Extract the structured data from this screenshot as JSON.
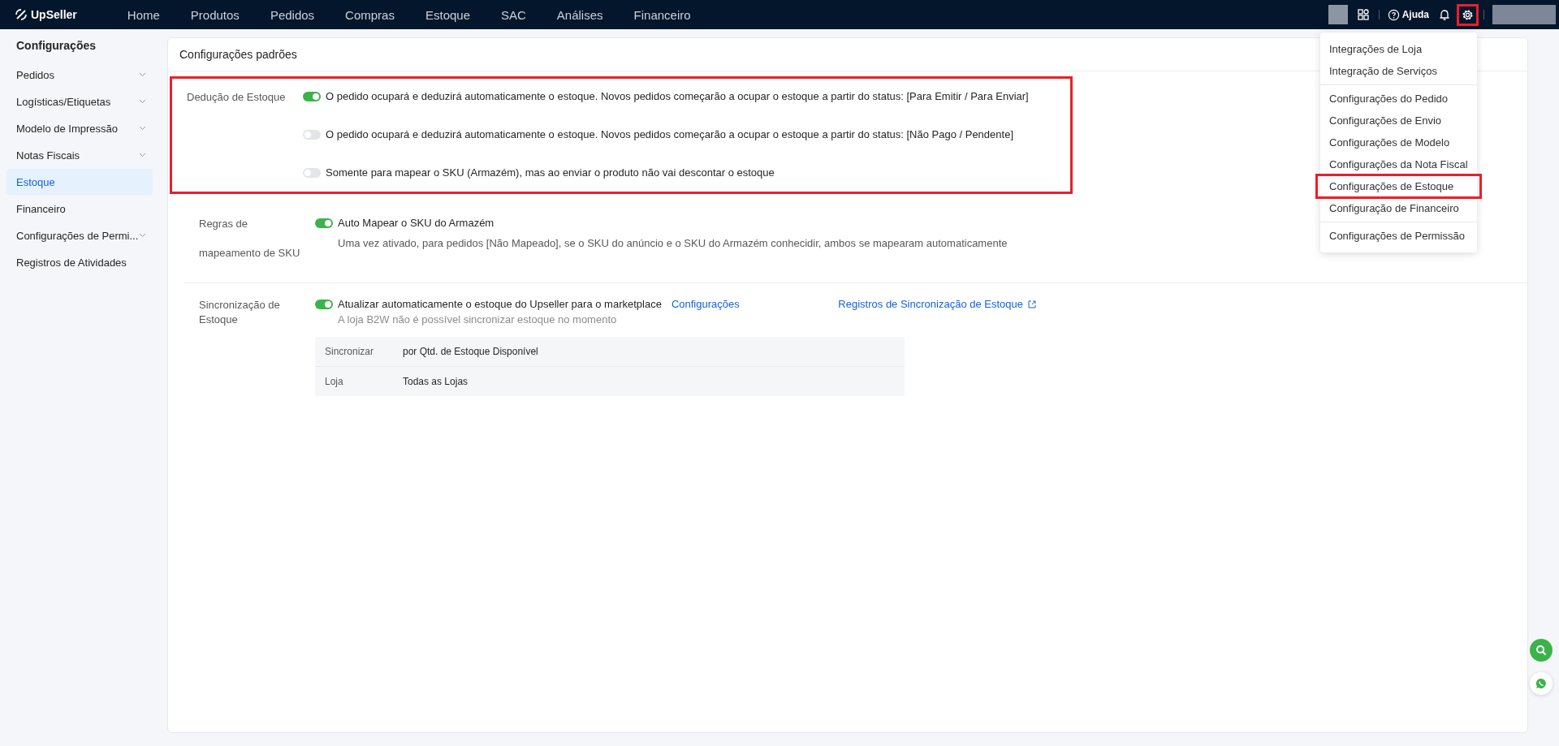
{
  "topbar": {
    "logo": "UpSeller",
    "settings_highlighted": true,
    "help": "Ajuda",
    "nav": [
      {
        "label": "Home",
        "selected": false
      },
      {
        "label": "Produtos",
        "selected": false
      },
      {
        "label": "Pedidos",
        "selected": false
      },
      {
        "label": "Compras",
        "selected": false
      },
      {
        "label": "Estoque",
        "selected": false
      },
      {
        "label": "SAC",
        "selected": false
      },
      {
        "label": "Análises",
        "selected": false
      },
      {
        "label": "Financeiro",
        "selected": false
      }
    ]
  },
  "sidebar": {
    "title": "Configurações",
    "items": [
      {
        "label": "Pedidos",
        "expandable": true,
        "selected": false
      },
      {
        "label": "Logísticas/Etiquetas",
        "expandable": true,
        "selected": false
      },
      {
        "label": "Modelo de Impressão",
        "expandable": true,
        "selected": false
      },
      {
        "label": "Notas Fiscais",
        "expandable": true,
        "selected": false
      },
      {
        "label": "Estoque",
        "expandable": false,
        "selected": true
      },
      {
        "label": "Financeiro",
        "expandable": false,
        "selected": false
      },
      {
        "label": "Configurações de Permi...",
        "expandable": true,
        "selected": false
      },
      {
        "label": "Registros de Atividades",
        "expandable": false,
        "selected": false
      }
    ]
  },
  "card": {
    "title": "Configurações padrões",
    "sections": [
      {
        "kind": "choices",
        "label": "Dedução de Estoque",
        "highlighted": true,
        "options": [
          {
            "text": "O pedido ocupará e deduzirá automaticamente o estoque. Novos pedidos começarão a ocupar o estoque a partir do status: [Para Emitir / Para Enviar]",
            "on": true
          },
          {
            "text": "O pedido ocupará e deduzirá automaticamente o estoque. Novos pedidos começarão a ocupar o estoque a partir do status: [Não Pago / Pendente]",
            "on": false
          },
          {
            "text": "Somente para mapear o SKU (Armazém), mas ao enviar o produto não vai descontar o estoque",
            "on": false
          }
        ]
      },
      {
        "kind": "mapping",
        "label": "Regras de mapeamento de SKU",
        "highlighted": false,
        "options": [
          {
            "text": "Auto Mapear o SKU do Armazém",
            "on": true,
            "note": "Uma vez ativado, para pedidos [Não Mapeado], se o SKU do anúncio e o SKU do Armazém conhecidir, ambos se mapearam automaticamente"
          }
        ]
      },
      {
        "kind": "sync",
        "label": "Sincronização de Estoque",
        "highlighted": false,
        "options": [
          {
            "text": "Atualizar automaticamente o estoque do Upseller para o marketplace",
            "on": true,
            "link": "Configurações",
            "side_link": "Registros de Sincronização de Estoque",
            "note": "A loja B2W não é possível sincronizar estoque no momento"
          }
        ],
        "table": [
          {
            "key": "Sincronizar",
            "value": "por Qtd. de Estoque Disponível"
          },
          {
            "key": "Loja",
            "value": "Todas as Lojas"
          }
        ]
      }
    ]
  },
  "settings_menu": {
    "groups": [
      [
        {
          "label": "Integrações de Loja",
          "highlighted": false
        },
        {
          "label": "Integração de Serviços",
          "highlighted": false
        }
      ],
      [
        {
          "label": "Configurações do Pedido",
          "highlighted": false
        },
        {
          "label": "Configurações de Envio",
          "highlighted": false
        },
        {
          "label": "Configurações de Modelo",
          "highlighted": false
        },
        {
          "label": "Configurações da Nota Fiscal",
          "highlighted": false
        },
        {
          "label": "Configurações de Estoque",
          "highlighted": true
        },
        {
          "label": "Configuração de Financeiro",
          "highlighted": false
        }
      ],
      [
        {
          "label": "Configurações de Permissão",
          "highlighted": false
        }
      ]
    ]
  }
}
